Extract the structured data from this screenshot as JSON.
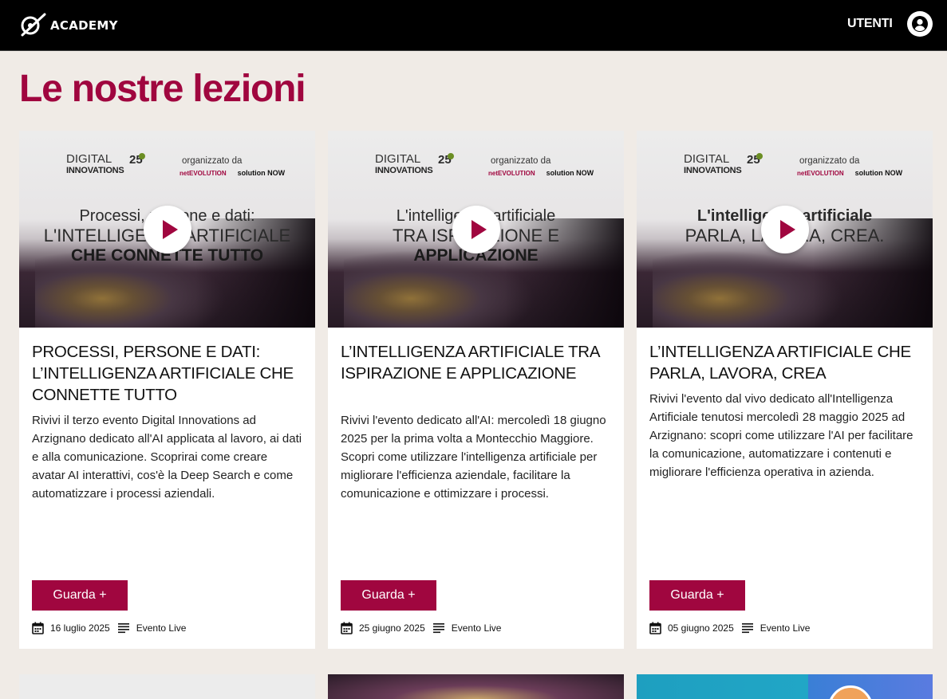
{
  "header": {
    "brand_label": "ACADEMY",
    "users_label": "UTENTI"
  },
  "page": {
    "title": "Le nostre lezioni"
  },
  "colors": {
    "accent": "#a0063f",
    "background": "#f0ebe6",
    "header": "#000000"
  },
  "lessons": [
    {
      "thumb": {
        "brand_line1": "DIGITAL",
        "brand_line2": "INNOVATIONS",
        "year": "25",
        "organizer_label": "organizzato da",
        "org_logo1": "netEVOLUTION",
        "org_logo2": "solution NOW",
        "line1": "Processi, persone e dati:",
        "line2": "L'INTELLIGENZA ARTIFICIALE",
        "line3": "CHE CONNETTE TUTTO"
      },
      "title": "PROCESSI, PERSONE E DATI: L’INTELLIGENZA ARTIFICIALE CHE CONNETTE TUTTO",
      "description": "Rivivi il terzo evento Digital Innovations ad Arzignano dedicato all'AI applicata al lavoro, ai dati e alla comunicazione. Scoprirai come creare avatar AI interattivi, cos'è la Deep Search e come automatizzare i processi aziendali.",
      "button_label": "Guarda +",
      "date": "16 luglio 2025",
      "type": "Evento Live"
    },
    {
      "thumb": {
        "brand_line1": "DIGITAL",
        "brand_line2": "INNOVATIONS",
        "year": "25",
        "organizer_label": "organizzato da",
        "org_logo1": "netEVOLUTION",
        "org_logo2": "solution NOW",
        "line1": "L'intelligenza artificiale",
        "line2": "TRA ISPIRAZIONE E",
        "line3": "APPLICAZIONE"
      },
      "title": "L’INTELLIGENZA ARTIFICIALE TRA ISPIRAZIONE E APPLICAZIONE",
      "description": "Rivivi l'evento dedicato all'AI: mercoledì 18 giugno 2025 per la prima volta a Montecchio Maggiore. Scopri come utilizzare l'intelligenza artificiale per migliorare l'efficienza aziendale, facilitare la comunicazione e ottimizzare i processi.",
      "button_label": "Guarda +",
      "date": "25 giugno 2025",
      "type": "Evento Live"
    },
    {
      "thumb": {
        "brand_line1": "DIGITAL",
        "brand_line2": "INNOVATIONS",
        "year": "25",
        "organizer_label": "organizzato da",
        "org_logo1": "netEVOLUTION",
        "org_logo2": "solution NOW",
        "line1": "L'intelligenza artificiale",
        "line2": "PARLA, LAVORA, CREA.",
        "line3": ""
      },
      "title": "L’INTELLIGENZA ARTIFICIALE CHE PARLA, LAVORA, CREA",
      "description": "Rivivi l'evento dal vivo dedicato all'Intelligenza Artificiale tenutosi mercoledì 28 maggio 2025 ad Arzignano: scopri come utilizzare l'AI per facilitare la comunicazione, automatizzare i contenuti e migliorare l'efficienza operativa in azienda.",
      "button_label": "Guarda +",
      "date": "05 giugno 2025",
      "type": "Evento Live"
    }
  ]
}
